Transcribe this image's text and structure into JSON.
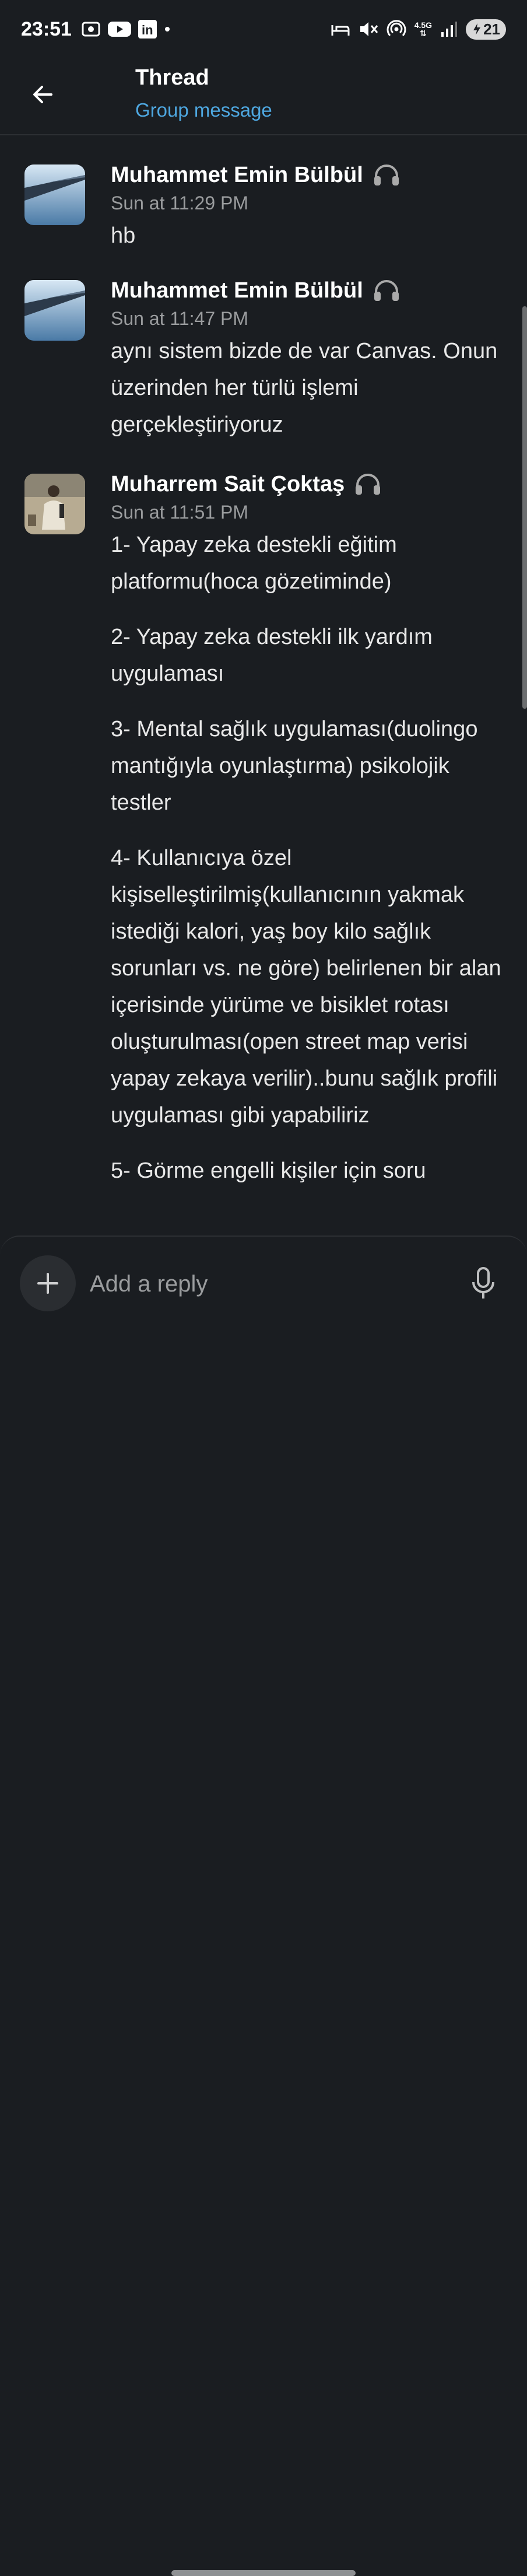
{
  "status_bar": {
    "time": "23:51",
    "network": "4.5G",
    "battery": "21"
  },
  "header": {
    "title": "Thread",
    "subtitle": "Group message"
  },
  "messages": [
    {
      "author": "Muhammet Emin Bülbül",
      "time": "Sun at 11:29 PM",
      "paragraphs": [
        "hb"
      ]
    },
    {
      "author": "Muhammet Emin Bülbül",
      "time": "Sun at 11:47 PM",
      "paragraphs": [
        "aynı sistem bizde de var Canvas. Onun üzerinden her türlü işlemi gerçekleştiriyoruz"
      ]
    },
    {
      "author": "Muharrem Sait Çoktaş",
      "time": "Sun at 11:51 PM",
      "paragraphs": [
        "1- Yapay zeka destekli eğitim platformu(hoca gözetiminde)",
        "2- Yapay zeka destekli ilk yardım uygulaması",
        "3- Mental sağlık uygulaması(duolingo mantığıyla oyunlaştırma) psikolojik testler",
        "4- Kullanıcıya özel kişiselleştirilmiş(kullanıcının yakmak istediği kalori, yaş boy kilo sağlık sorunları vs. ne göre) belirlenen bir alan içerisinde yürüme ve bisiklet rotası oluşturulması(open street map verisi yapay zekaya verilir)..bunu sağlık profili uygulaması gibi yapabiliriz",
        "5- Görme engelli kişiler için soru"
      ]
    }
  ],
  "composer": {
    "placeholder": "Add a reply"
  },
  "icons": {
    "back": "arrow-left-icon",
    "status": "headphones-icon",
    "add": "plus-icon",
    "mic": "microphone-icon"
  },
  "colors": {
    "background": "#1a1d21",
    "link": "#4ea7e0",
    "muted": "#9a9c9e"
  }
}
